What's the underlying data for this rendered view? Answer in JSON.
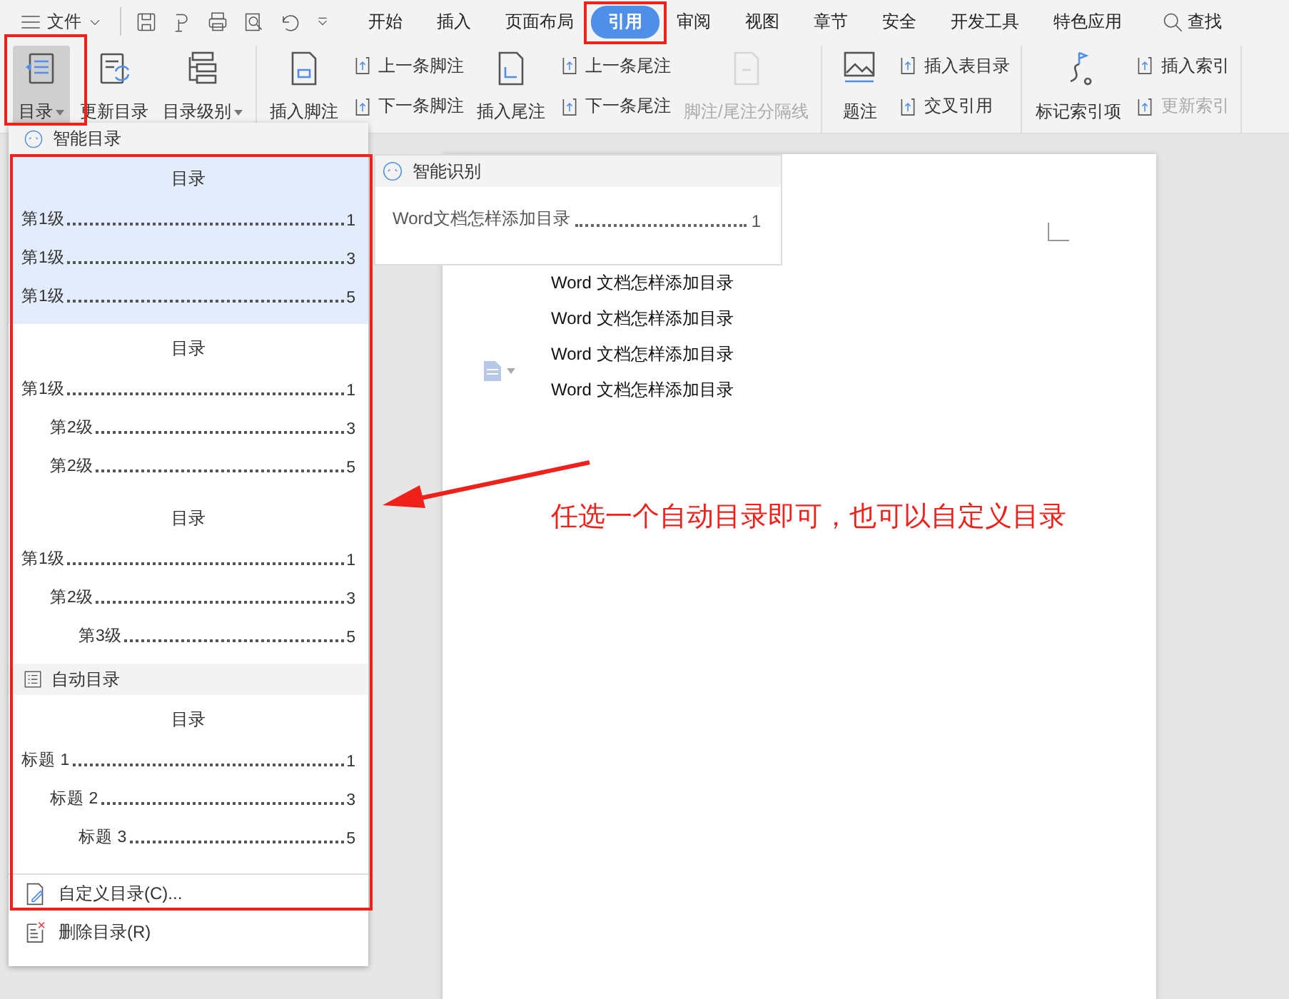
{
  "topbar": {
    "file_label": "文件",
    "tabs": [
      {
        "label": "开始",
        "selected": false
      },
      {
        "label": "插入",
        "selected": false
      },
      {
        "label": "页面布局",
        "selected": false
      },
      {
        "label": "引用",
        "selected": true
      },
      {
        "label": "审阅",
        "selected": false
      },
      {
        "label": "视图",
        "selected": false
      },
      {
        "label": "章节",
        "selected": false
      },
      {
        "label": "安全",
        "selected": false
      },
      {
        "label": "开发工具",
        "selected": false
      },
      {
        "label": "特色应用",
        "selected": false
      }
    ],
    "search": "查找"
  },
  "ribbon": {
    "groups": [
      {
        "items": [
          {
            "kind": "big",
            "label": "目录",
            "dropdown": true,
            "selected": true,
            "disabled": false
          },
          {
            "kind": "big",
            "label": "更新目录",
            "dropdown": false,
            "selected": false,
            "disabled": false
          },
          {
            "kind": "big",
            "label": "目录级别",
            "dropdown": true,
            "selected": false,
            "disabled": false
          }
        ]
      },
      {
        "items": [
          {
            "kind": "big",
            "label": "插入脚注",
            "dropdown": false,
            "selected": false,
            "disabled": false
          },
          {
            "kind": "pair",
            "labels": [
              "上一条脚注",
              "下一条脚注"
            ],
            "disabled": [
              false,
              false
            ]
          },
          {
            "kind": "big",
            "label": "插入尾注",
            "dropdown": false,
            "selected": false,
            "disabled": false
          },
          {
            "kind": "pair",
            "labels": [
              "上一条尾注",
              "下一条尾注"
            ],
            "disabled": [
              false,
              false
            ]
          },
          {
            "kind": "big",
            "label": "脚注/尾注分隔线",
            "dropdown": false,
            "selected": false,
            "disabled": true
          }
        ]
      },
      {
        "items": [
          {
            "kind": "big",
            "label": "题注",
            "dropdown": false,
            "selected": false,
            "disabled": false
          },
          {
            "kind": "pair",
            "labels": [
              "插入表目录",
              "交叉引用"
            ],
            "disabled": [
              false,
              false
            ]
          }
        ]
      },
      {
        "items": [
          {
            "kind": "big",
            "label": "标记索引项",
            "dropdown": false,
            "selected": false,
            "disabled": false
          },
          {
            "kind": "pair",
            "labels": [
              "插入索引",
              "更新索引"
            ],
            "disabled": [
              false,
              true
            ]
          }
        ]
      }
    ]
  },
  "toc_menu": {
    "sections": [
      {
        "kind": "header",
        "label": "智能目录"
      },
      {
        "kind": "preset",
        "selected": true,
        "title": "目录",
        "entries": [
          {
            "label": "第1级",
            "page": "1"
          },
          {
            "label": "第1级",
            "page": "3"
          },
          {
            "label": "第1级",
            "page": "5"
          }
        ]
      },
      {
        "kind": "preset",
        "selected": false,
        "title": "目录",
        "entries": [
          {
            "label": "第1级",
            "page": "1",
            "children": [
              {
                "label": "第2级",
                "page": "3"
              },
              {
                "label": "第2级",
                "page": "5"
              }
            ]
          }
        ]
      },
      {
        "kind": "preset",
        "selected": false,
        "title": "目录",
        "entries": [
          {
            "label": "第1级",
            "page": "1",
            "children": [
              {
                "label": "第2级",
                "page": "3",
                "children": [
                  {
                    "label": "第3级",
                    "page": "5"
                  }
                ]
              }
            ]
          }
        ]
      },
      {
        "kind": "header",
        "label": "自动目录"
      },
      {
        "kind": "preset",
        "selected": false,
        "title": "目录",
        "entries": [
          {
            "label": "标题 1",
            "page": "1",
            "children": [
              {
                "label": "标题 2",
                "page": "3",
                "children": [
                  {
                    "label": "标题 3",
                    "page": "5"
                  }
                ]
              }
            ]
          }
        ]
      },
      {
        "kind": "action",
        "label": "自定义目录(C)..."
      },
      {
        "kind": "action",
        "label": "删除目录(R)"
      }
    ]
  },
  "submenu": {
    "header": "智能识别",
    "entries": [
      {
        "label": "Word文档怎样添加目录",
        "page": "1"
      }
    ]
  },
  "document": {
    "lines": [
      "Word 文档怎样添加目录",
      "Word 文档怎样添加目录",
      "Word 文档怎样添加目录",
      "Word 文档怎样添加目录"
    ]
  },
  "annotation": {
    "text": "任选一个自动目录即可，也可以自定义目录"
  }
}
